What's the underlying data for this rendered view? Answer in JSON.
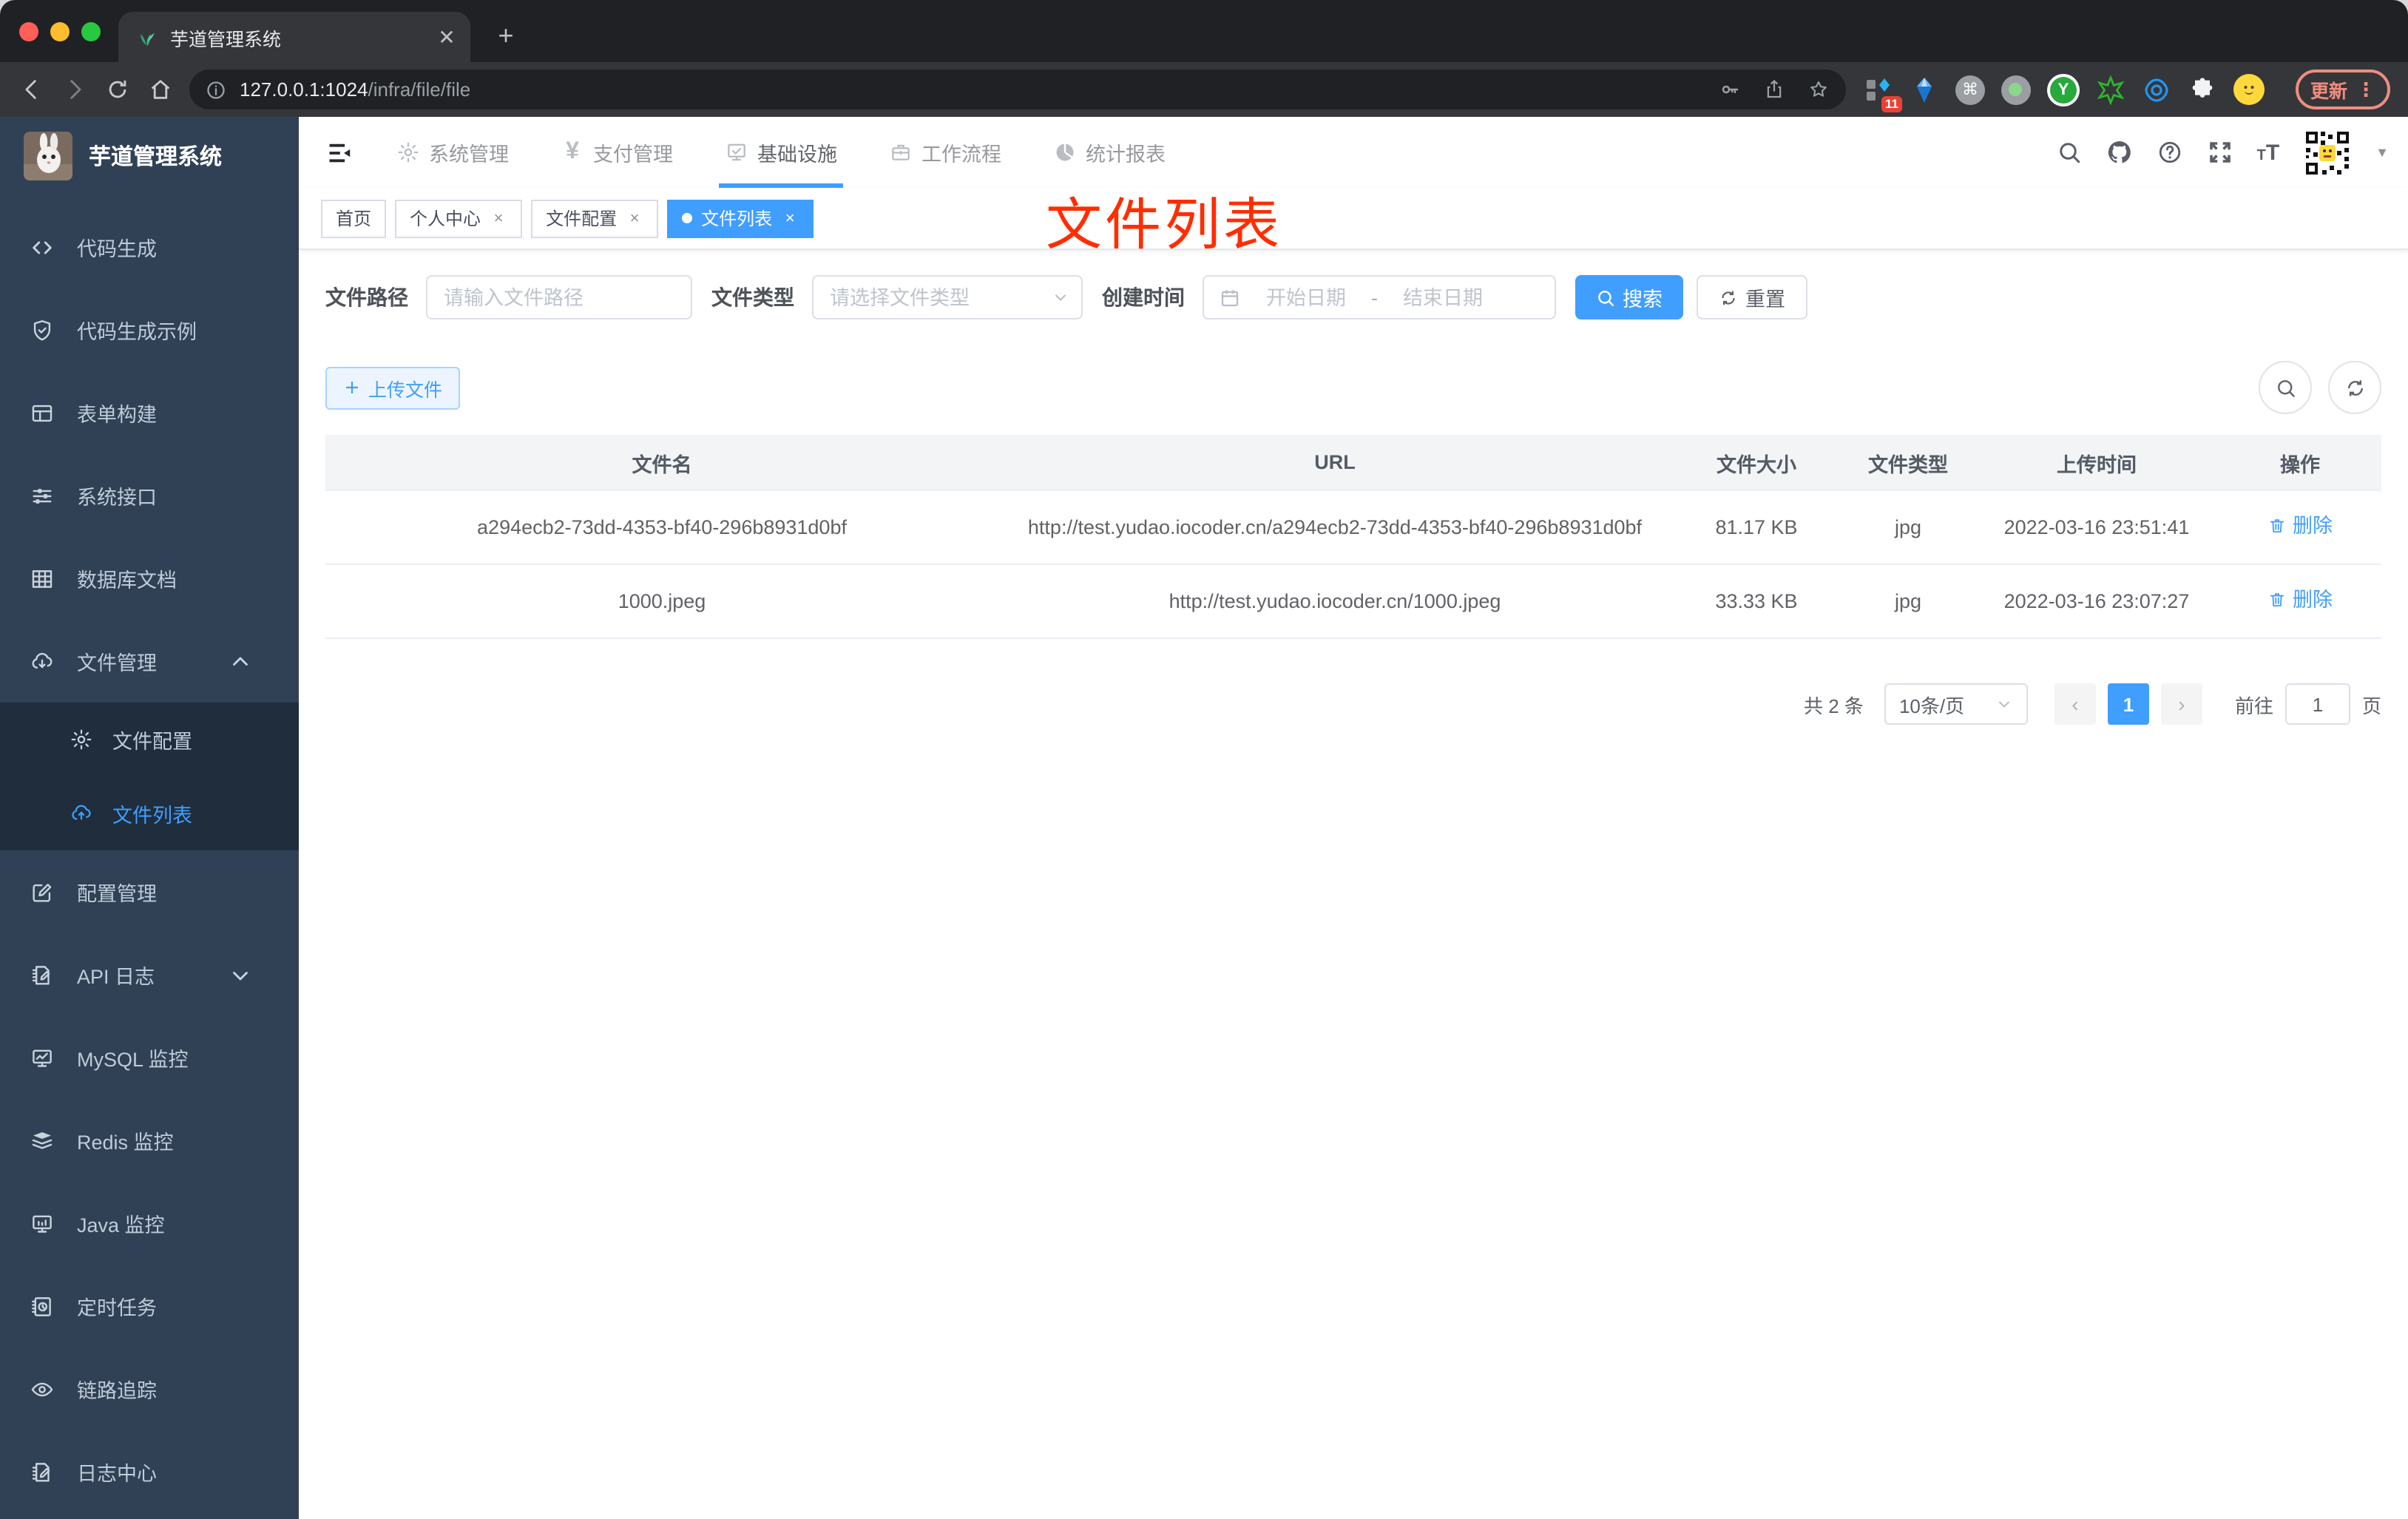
{
  "browser": {
    "tab_title": "芋道管理系统",
    "url_host": "127.0.0.1:1024",
    "url_path": "/infra/file/file",
    "extension_badge": "11",
    "update_label": "更新"
  },
  "sidebar": {
    "title": "芋道管理系统",
    "menu": [
      {
        "id": "code-gen",
        "icon": "code-icon",
        "label": "代码生成"
      },
      {
        "id": "code-gen-demo",
        "icon": "shield-check-icon",
        "label": "代码生成示例"
      },
      {
        "id": "form-build",
        "icon": "form-icon",
        "label": "表单构建"
      },
      {
        "id": "system-api",
        "icon": "sliders-icon",
        "label": "系统接口"
      },
      {
        "id": "db-doc",
        "icon": "grid-icon",
        "label": "数据库文档"
      },
      {
        "id": "file-manage",
        "icon": "cloud-download-icon",
        "label": "文件管理",
        "expanded": true,
        "children": [
          {
            "id": "file-config",
            "icon": "gear-icon",
            "label": "文件配置"
          },
          {
            "id": "file-list",
            "icon": "cloud-upload-icon",
            "label": "文件列表",
            "active": true
          }
        ]
      },
      {
        "id": "config-manage",
        "icon": "edit-icon",
        "label": "配置管理"
      },
      {
        "id": "api-log",
        "icon": "doc-edit-icon",
        "label": "API 日志",
        "collapsed": true
      },
      {
        "id": "mysql-monitor",
        "icon": "chart-monitor-icon",
        "label": "MySQL 监控"
      },
      {
        "id": "redis-monitor",
        "icon": "layers-icon",
        "label": "Redis 监控"
      },
      {
        "id": "java-monitor",
        "icon": "monitor-icon",
        "label": "Java 监控"
      },
      {
        "id": "cron-job",
        "icon": "schedule-icon",
        "label": "定时任务"
      },
      {
        "id": "trace",
        "icon": "eye-icon",
        "label": "链路追踪"
      },
      {
        "id": "log-center",
        "icon": "log-edit-icon",
        "label": "日志中心"
      }
    ]
  },
  "header": {
    "nav": [
      {
        "id": "system",
        "icon": "gear-icon",
        "label": "系统管理"
      },
      {
        "id": "pay",
        "icon": "yen-icon",
        "label": "支付管理"
      },
      {
        "id": "infra",
        "icon": "monitor-check-icon",
        "label": "基础设施",
        "active": true
      },
      {
        "id": "workflow",
        "icon": "briefcase-icon",
        "label": "工作流程"
      },
      {
        "id": "report",
        "icon": "pie-chart-icon",
        "label": "统计报表"
      }
    ]
  },
  "tags": [
    {
      "id": "home",
      "label": "首页",
      "closable": false,
      "active": false
    },
    {
      "id": "profile",
      "label": "个人中心",
      "closable": true,
      "active": false
    },
    {
      "id": "file-config",
      "label": "文件配置",
      "closable": true,
      "active": false
    },
    {
      "id": "file-list",
      "label": "文件列表",
      "closable": true,
      "active": true
    }
  ],
  "annotation": {
    "text": "文件列表"
  },
  "filters": {
    "path_label": "文件路径",
    "path_placeholder": "请输入文件路径",
    "type_label": "文件类型",
    "type_placeholder": "请选择文件类型",
    "date_label": "创建时间",
    "date_start_placeholder": "开始日期",
    "date_separator": "-",
    "date_end_placeholder": "结束日期",
    "search_label": "搜索",
    "reset_label": "重置"
  },
  "actions": {
    "upload_label": "上传文件"
  },
  "table": {
    "columns": [
      "文件名",
      "URL",
      "文件大小",
      "文件类型",
      "上传时间",
      "操作"
    ],
    "rows": [
      {
        "name": "a294ecb2-73dd-4353-bf40-296b8931d0bf",
        "url": "http://test.yudao.iocoder.cn/a294ecb2-73dd-4353-bf40-296b8931d0bf",
        "size": "81.17 KB",
        "type": "jpg",
        "time": "2022-03-16 23:51:41",
        "action": "删除"
      },
      {
        "name": "1000.jpeg",
        "url": "http://test.yudao.iocoder.cn/1000.jpeg",
        "size": "33.33 KB",
        "type": "jpg",
        "time": "2022-03-16 23:07:27",
        "action": "删除"
      }
    ]
  },
  "pagination": {
    "total": "共 2 条",
    "page_size": "10条/页",
    "current_page": "1",
    "goto_label": "前往",
    "goto_value": "1",
    "unit_label": "页"
  },
  "colors": {
    "accent": "#409eff",
    "sidebar_bg": "#304156",
    "submenu_bg": "#1f2d3d",
    "annotation": "#ff2d00",
    "tag_active": "#409eff"
  }
}
